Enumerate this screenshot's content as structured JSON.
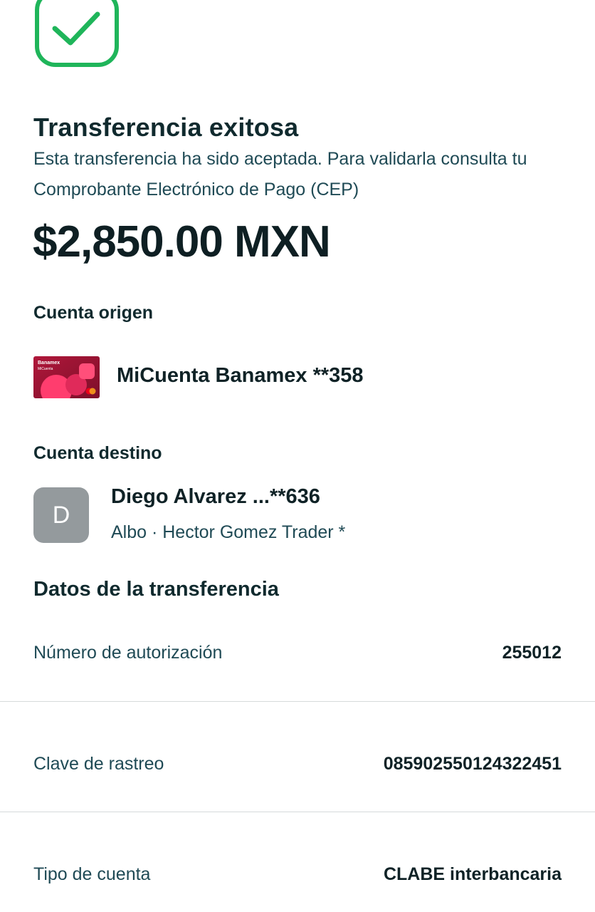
{
  "status": {
    "title": "Transferencia exitosa",
    "subtitle": "Esta transferencia ha sido aceptada. Para validarla consulta tu Comprobante Electrónico de Pago (CEP)",
    "amount": "$2,850.00 MXN",
    "icon": "check-icon",
    "accent_color": "#1db954"
  },
  "origin": {
    "label": "Cuenta origen",
    "account_name": "MiCuenta Banamex **358",
    "card_brand": "Banamex",
    "card_product": "MiCuenta"
  },
  "destination": {
    "label": "Cuenta destino",
    "avatar_initial": "D",
    "name": "Diego Alvarez ...**636",
    "detail": "Albo · Hector Gomez Trader *"
  },
  "details": {
    "title": "Datos de la transferencia",
    "rows": [
      {
        "label": "Número de autorización",
        "value": "255012"
      },
      {
        "label": "Clave de rastreo",
        "value": "085902550124322451"
      },
      {
        "label": "Tipo de cuenta",
        "value": "CLABE interbancaria"
      }
    ]
  }
}
